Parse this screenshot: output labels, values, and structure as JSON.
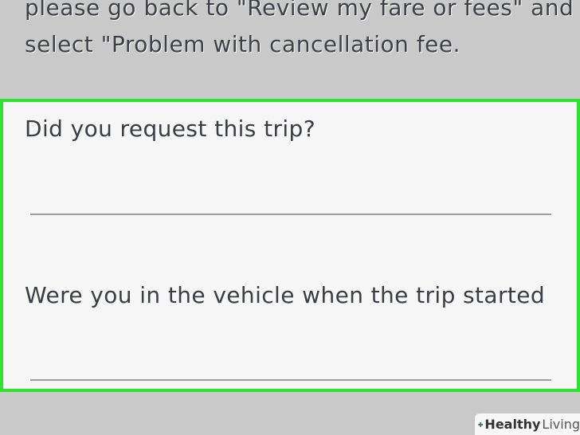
{
  "intro": {
    "text": "please go back to \"Review my fare or fees\" and\nselect \"Problem with cancellation fee."
  },
  "form": {
    "questions": [
      {
        "label": "Did you request this trip?",
        "value": ""
      },
      {
        "label": "Were you in the vehicle when the trip started",
        "value": ""
      }
    ],
    "highlight_color": "#2ee32e"
  },
  "watermark": {
    "bold": "Healthy",
    "light": "Living",
    "icon": "plus-icon",
    "colors": [
      "#2a8a3e",
      "#1f6fb2"
    ]
  }
}
